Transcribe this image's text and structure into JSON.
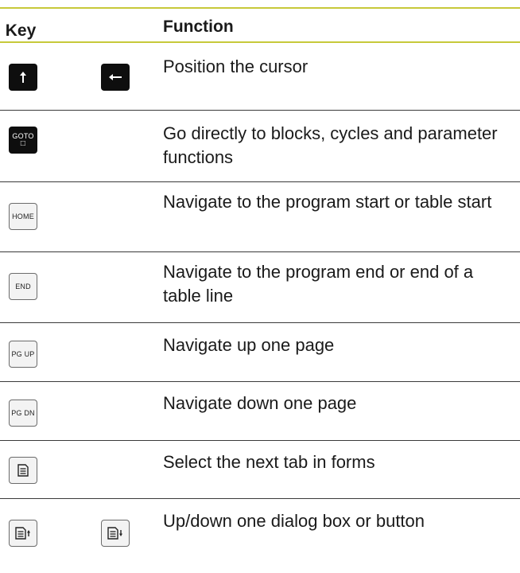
{
  "header": {
    "key": "Key",
    "function": "Function"
  },
  "rows": [
    {
      "keys": [
        {
          "icon": "arrow-up-icon"
        },
        {
          "icon": "arrow-left-icon"
        }
      ],
      "function": "Position the cursor"
    },
    {
      "keys": [
        {
          "label": "GOTO",
          "sub": "□"
        }
      ],
      "function": "Go directly to blocks, cycles and parameter functions"
    },
    {
      "keys": [
        {
          "label": "HOME"
        }
      ],
      "function": "Navigate to the program start or table start"
    },
    {
      "keys": [
        {
          "label": "END"
        }
      ],
      "function": "Navigate to the program end or end of a table line"
    },
    {
      "keys": [
        {
          "label": "PG UP"
        }
      ],
      "function": "Navigate up one page"
    },
    {
      "keys": [
        {
          "label": "PG DN"
        }
      ],
      "function": "Navigate down one page"
    },
    {
      "keys": [
        {
          "icon": "form-tab-icon"
        }
      ],
      "function": "Select the next tab in forms"
    },
    {
      "keys": [
        {
          "icon": "form-up-icon"
        },
        {
          "icon": "form-down-icon"
        }
      ],
      "function": "Up/down one dialog box or button"
    }
  ]
}
